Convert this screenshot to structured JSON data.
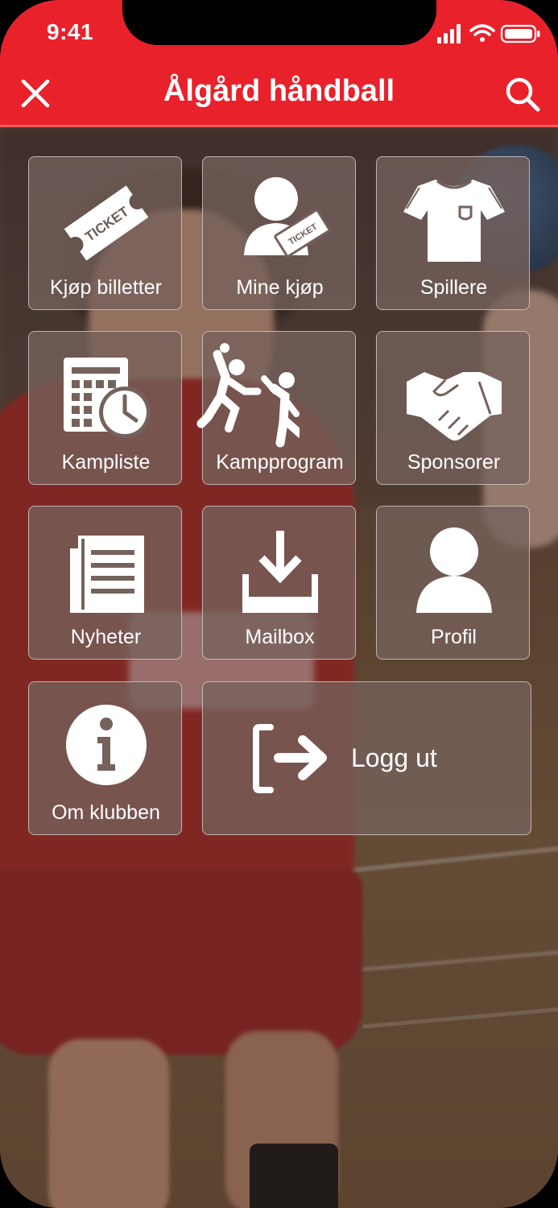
{
  "status_bar": {
    "time": "9:41"
  },
  "header": {
    "title": "Ålgård håndball"
  },
  "menu": {
    "items": [
      {
        "label": "Kjøp billetter",
        "icon": "ticket-icon",
        "ticket_text": "TICKET"
      },
      {
        "label": "Mine kjøp",
        "icon": "user-ticket-icon",
        "ticket_text": "TICKET"
      },
      {
        "label": "Spillere",
        "icon": "jersey-icon"
      },
      {
        "label": "Kampliste",
        "icon": "calendar-clock-icon"
      },
      {
        "label": "Kampprogram",
        "icon": "handball-players-icon"
      },
      {
        "label": "Sponsorer",
        "icon": "handshake-icon"
      },
      {
        "label": "Nyheter",
        "icon": "newspaper-icon"
      },
      {
        "label": "Mailbox",
        "icon": "inbox-download-icon"
      },
      {
        "label": "Profil",
        "icon": "person-icon"
      },
      {
        "label": "Om klubben",
        "icon": "info-icon"
      },
      {
        "label": "Logg ut",
        "icon": "logout-icon"
      }
    ]
  },
  "colors": {
    "header": "#e8212b",
    "tile_background": "rgba(118, 98, 92, 0.78)",
    "tile_border": "rgba(255,255,255,0.55)",
    "text": "#ffffff"
  }
}
